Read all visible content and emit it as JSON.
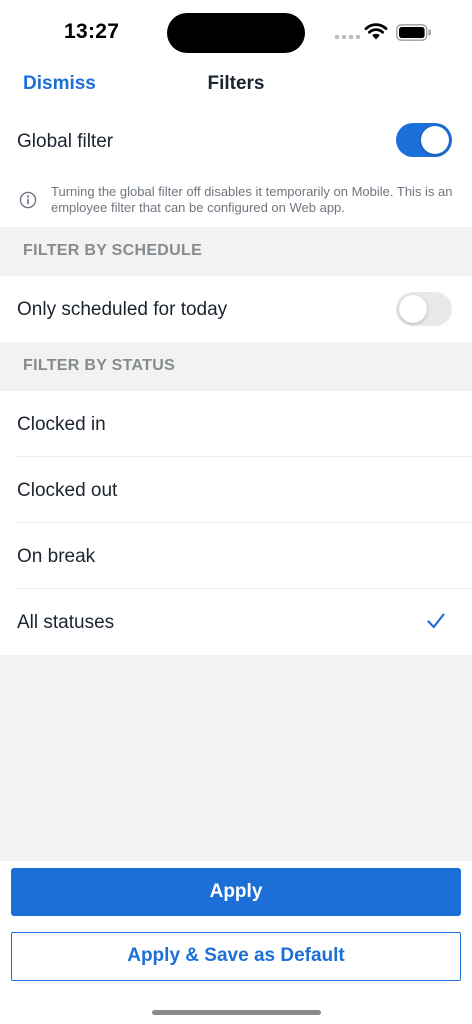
{
  "status_bar": {
    "time": "13:27"
  },
  "nav": {
    "dismiss_label": "Dismiss",
    "title": "Filters"
  },
  "global_filter": {
    "label": "Global filter",
    "enabled": true,
    "info_text": "Turning the global filter off disables it temporarily on Mobile. This is an employee filter that can be configured on Web app."
  },
  "schedule_section": {
    "header": "FILTER BY SCHEDULE",
    "items": [
      {
        "label": "Only scheduled for today",
        "enabled": false
      }
    ]
  },
  "status_section": {
    "header": "FILTER BY STATUS",
    "items": [
      {
        "label": "Clocked in",
        "selected": false
      },
      {
        "label": "Clocked out",
        "selected": false
      },
      {
        "label": "On break",
        "selected": false
      },
      {
        "label": "All statuses",
        "selected": true
      }
    ]
  },
  "actions": {
    "apply_label": "Apply",
    "save_default_label": "Apply & Save as Default"
  },
  "colors": {
    "accent": "#1d6fd8",
    "section_bg": "#f1f2f1",
    "toggle_off": "#e9e9ea"
  }
}
